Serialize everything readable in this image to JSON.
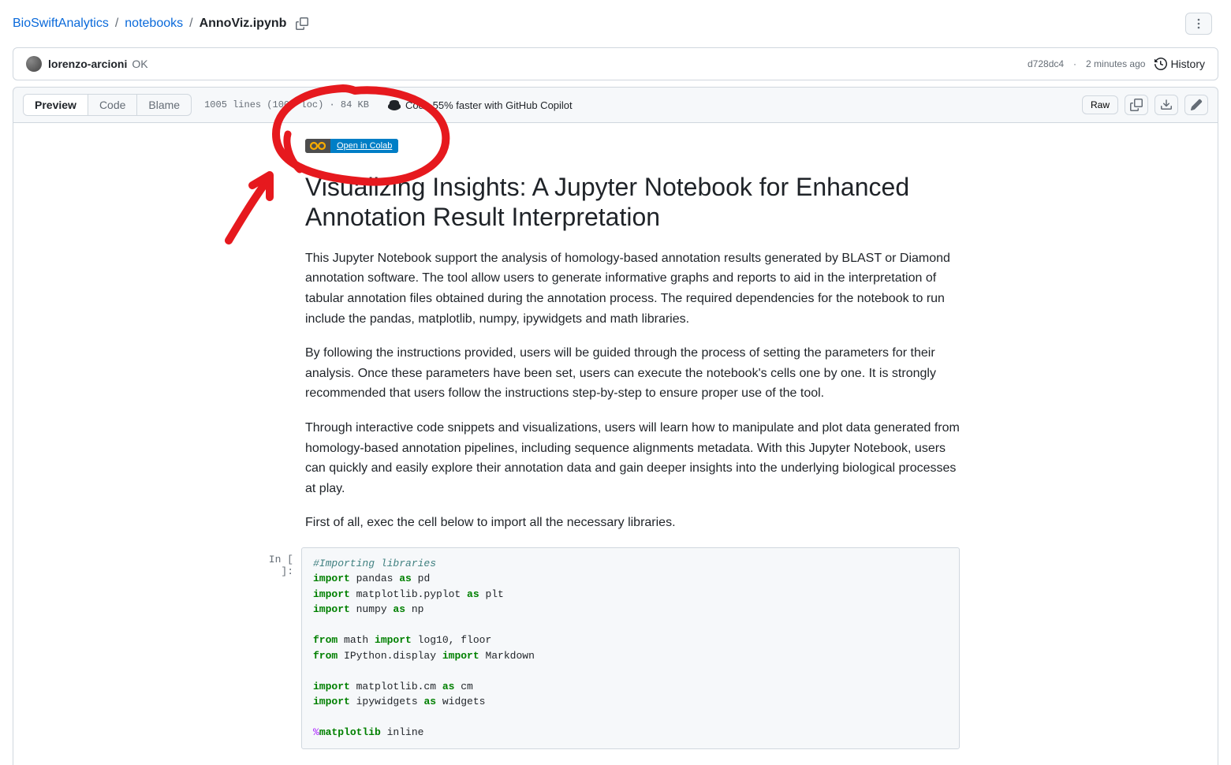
{
  "breadcrumb": {
    "repo": "BioSwiftAnalytics",
    "folder": "notebooks",
    "file": "AnnoViz.ipynb"
  },
  "commit": {
    "author": "lorenzo-arcioni",
    "message": "OK",
    "sha": "d728dc4",
    "time": "2 minutes ago",
    "history_label": "History"
  },
  "toolbar": {
    "tabs": {
      "preview": "Preview",
      "code": "Code",
      "blame": "Blame"
    },
    "file_info": "1005 lines (1005 loc) · 84 KB",
    "copilot": "Code 55% faster with GitHub Copilot",
    "raw": "Raw"
  },
  "badge": {
    "text": "Open in Colab"
  },
  "doc": {
    "title": "Visualizing Insights: A Jupyter Notebook for Enhanced Annotation Result Interpretation",
    "p1": "This Jupyter Notebook support the analysis of homology-based annotation results generated by BLAST or Diamond annotation software. The tool allow users to generate informative graphs and reports to aid in the interpretation of tabular annotation files obtained during the annotation process. The required dependencies for the notebook to run include the pandas, matplotlib, numpy, ipywidgets and math libraries.",
    "p2": "By following the instructions provided, users will be guided through the process of setting the parameters for their analysis. Once these parameters have been set, users can execute the notebook's cells one by one. It is strongly recommended that users follow the instructions step-by-step to ensure proper use of the tool.",
    "p3": "Through interactive code snippets and visualizations, users will learn how to manipulate and plot data generated from homology-based annotation pipelines, including sequence alignments metadata. With this Jupyter Notebook, users can quickly and easily explore their annotation data and gain deeper insights into the underlying biological processes at play.",
    "p4": "First of all, exec the cell below to import all the necessary libraries."
  },
  "cell": {
    "prompt": "In [ ]:",
    "c0": "#Importing libraries",
    "l1_kw1": "import",
    "l1_txt": " pandas ",
    "l1_kw2": "as",
    "l1_alias": " pd",
    "l2_kw1": "import",
    "l2_txt": " matplotlib.pyplot ",
    "l2_kw2": "as",
    "l2_alias": " plt",
    "l3_kw1": "import",
    "l3_txt": " numpy ",
    "l3_kw2": "as",
    "l3_alias": " np",
    "l4_kw1": "from",
    "l4_mod": " math ",
    "l4_kw2": "import",
    "l4_names": " log10, floor",
    "l5_kw1": "from",
    "l5_mod": " IPython.display ",
    "l5_kw2": "import",
    "l5_names": " Markdown",
    "l6_kw1": "import",
    "l6_txt": " matplotlib.cm ",
    "l6_kw2": "as",
    "l6_alias": " cm",
    "l7_kw1": "import",
    "l7_txt": " ipywidgets ",
    "l7_kw2": "as",
    "l7_alias": " widgets",
    "l8_magic": "%",
    "l8_kw": "matplotlib",
    "l8_arg": " inline"
  }
}
